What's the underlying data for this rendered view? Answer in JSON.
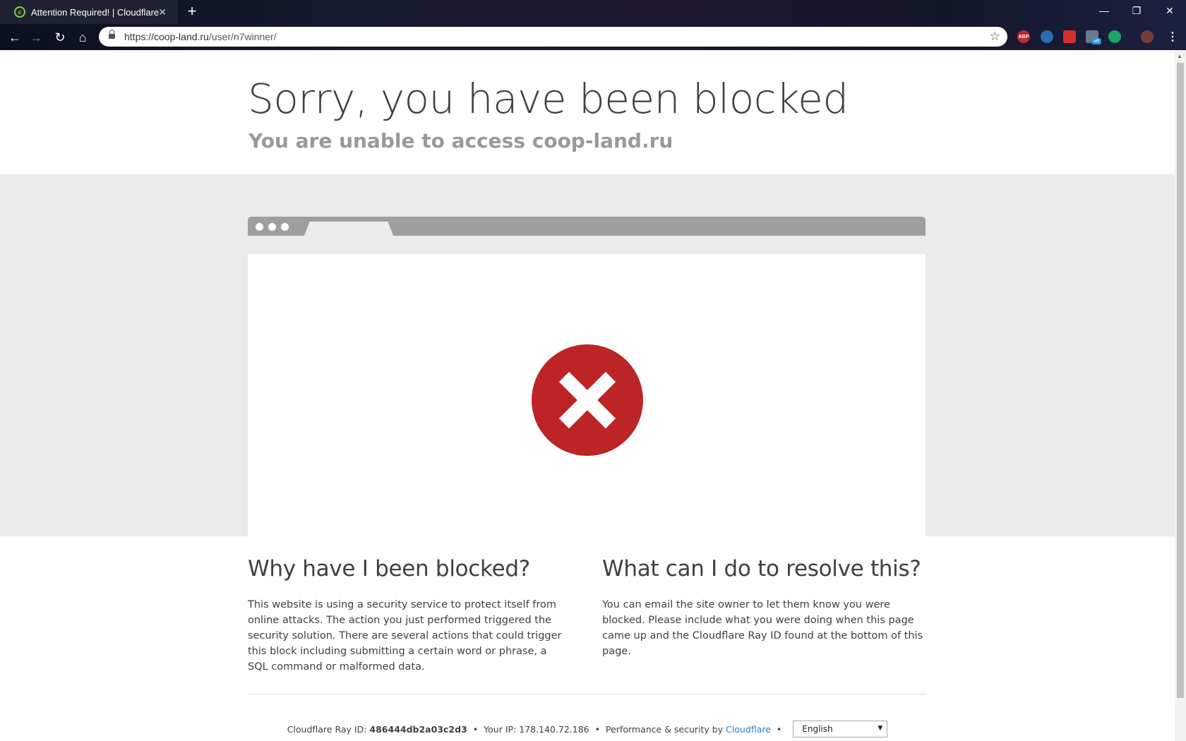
{
  "browser": {
    "tab_title": "Attention Required! | Cloudflare",
    "tab_close": "✕",
    "new_tab": "+",
    "url_host": "https://coop-land.ru",
    "url_path": "/user/n7winner/",
    "extensions": [
      "ABP",
      "",
      "",
      "off",
      "",
      ""
    ]
  },
  "header": {
    "title": "Sorry, you have been blocked",
    "subtitle": "You are unable to access coop-land.ru"
  },
  "why": {
    "heading": "Why have I been blocked?",
    "body": "This website is using a security service to protect itself from online attacks. The action you just performed triggered the security solution. There are several actions that could trigger this block including submitting a certain word or phrase, a SQL command or malformed data."
  },
  "resolve": {
    "heading": "What can I do to resolve this?",
    "body": "You can email the site owner to let them know you were blocked. Please include what you were doing when this page came up and the Cloudflare Ray ID found at the bottom of this page."
  },
  "footer": {
    "ray_label": "Cloudflare Ray ID:",
    "ray_id": "486444db2a03c2d3",
    "ip_label": "Your IP: 178.140.72.186",
    "perf_label": "Performance & security by",
    "cloudflare_link": "Cloudflare",
    "language": "English"
  },
  "colors": {
    "error_red": "#bd2426",
    "link_blue": "#2f7bbf"
  }
}
